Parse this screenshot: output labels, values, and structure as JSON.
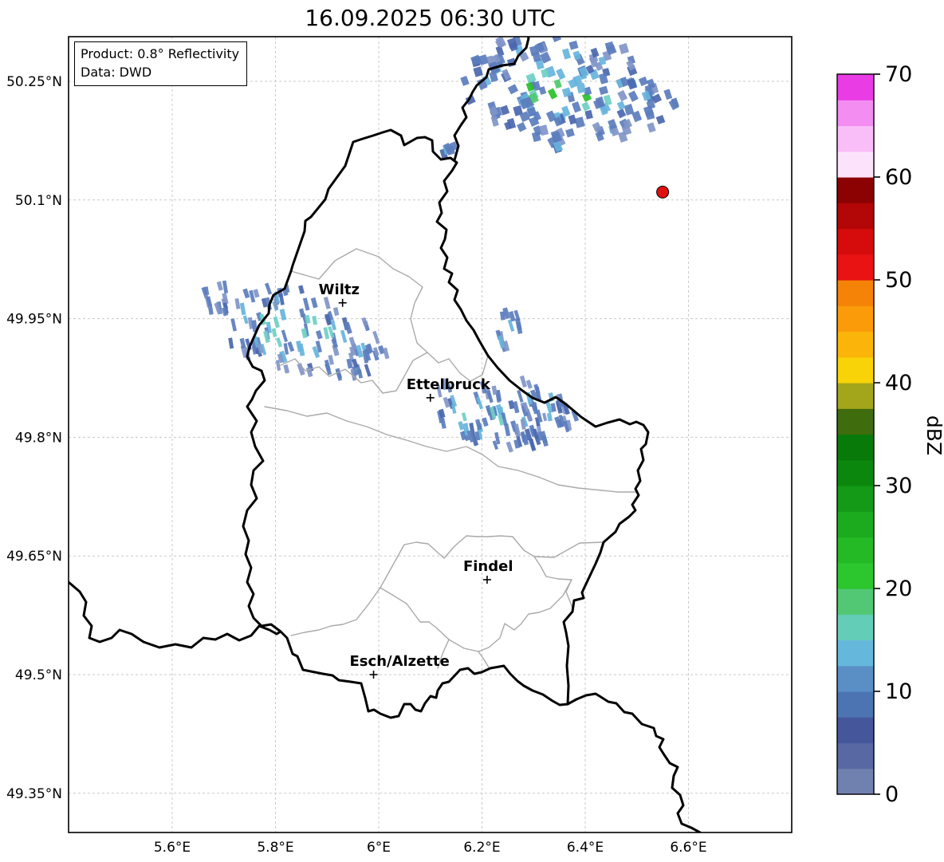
{
  "title": "16.09.2025 06:30 UTC",
  "info_box": {
    "line1": "Product: 0.8° Reflectivity",
    "line2": "Data: DWD"
  },
  "map": {
    "x_ticks": [
      {
        "label": "5.6°E",
        "lon": 5.6
      },
      {
        "label": "5.8°E",
        "lon": 5.8
      },
      {
        "label": "6°E",
        "lon": 6.0
      },
      {
        "label": "6.2°E",
        "lon": 6.2
      },
      {
        "label": "6.4°E",
        "lon": 6.4
      },
      {
        "label": "6.6°E",
        "lon": 6.6
      }
    ],
    "y_ticks": [
      {
        "label": "50.25°N",
        "lat": 50.25
      },
      {
        "label": "50.1°N",
        "lat": 50.1
      },
      {
        "label": "49.95°N",
        "lat": 49.95
      },
      {
        "label": "49.8°N",
        "lat": 49.8
      },
      {
        "label": "49.65°N",
        "lat": 49.65
      },
      {
        "label": "49.5°N",
        "lat": 49.5
      },
      {
        "label": "49.35°N",
        "lat": 49.35
      }
    ],
    "cities": [
      {
        "name": "Wiltz",
        "lon": 5.93,
        "lat": 49.97
      },
      {
        "name": "Ettelbruck",
        "lon": 6.1,
        "lat": 49.85
      },
      {
        "name": "Findel",
        "lon": 6.21,
        "lat": 49.62
      },
      {
        "name": "Esch/Alzette",
        "lon": 5.99,
        "lat": 49.5
      }
    ],
    "radar_site": {
      "lon": 6.55,
      "lat": 50.11,
      "color": "#e01010"
    }
  },
  "colorbar": {
    "label": "dBZ",
    "min": 0,
    "max": 70,
    "segment_step": 2.5,
    "tick_values": [
      0,
      10,
      20,
      30,
      40,
      50,
      60,
      70
    ],
    "colors_bottom_to_top": [
      "#7181af",
      "#5868a3",
      "#45569b",
      "#4c74b3",
      "#5a8fc6",
      "#66b7dc",
      "#63cdb7",
      "#52c874",
      "#2cc62e",
      "#24ba26",
      "#1cab1e",
      "#149a16",
      "#0c870e",
      "#077a0a",
      "#3f6c0d",
      "#a3a51a",
      "#f7d308",
      "#fbb40a",
      "#fb9b09",
      "#f58307",
      "#ea1313",
      "#d60c0c",
      "#b30606",
      "#8c0202",
      "#fde2fb",
      "#f9bdf7",
      "#f48df2",
      "#e93ce5"
    ]
  },
  "chart_data": {
    "type": "radar_reflectivity_map",
    "timestamp_utc": "16.09.2025 06:30",
    "product": "0.8° Reflectivity",
    "data_source": "DWD",
    "map_extent": {
      "lon_min": 5.4,
      "lon_max": 6.8,
      "lat_min": 49.29,
      "lat_max": 50.3
    },
    "grid": "dashed graticule every 0.2°E / 0.15°N",
    "echo_palette": [
      "#8095c8",
      "#5b7dbd",
      "#4a67ae",
      "#66b4dc",
      "#6fcfc4",
      "#4dc96b",
      "#28c128"
    ],
    "echo_clusters": [
      {
        "name": "north-germany-belgium",
        "lon": 6.367,
        "lat": 50.24,
        "rlon": 0.205,
        "rlat": 0.07,
        "cells": 165,
        "style": "block",
        "shear": 0.35,
        "green": 0.22,
        "approx_dbz": "0-35"
      },
      {
        "name": "north-small",
        "lon": 6.343,
        "lat": 50.172,
        "rlon": 0.012,
        "rlat": 0.008,
        "cells": 4,
        "style": "block",
        "shear": 0.2,
        "green": 0.0,
        "approx_dbz": "0-10"
      },
      {
        "name": "ne-border-spot",
        "lon": 6.136,
        "lat": 50.164,
        "rlon": 0.014,
        "rlat": 0.01,
        "cells": 5,
        "style": "block",
        "shear": 0.2,
        "green": 0.0,
        "approx_dbz": "0-15"
      },
      {
        "name": "wiltz-band",
        "lon": 5.835,
        "lat": 49.936,
        "rlon": 0.155,
        "rlat": 0.064,
        "cells": 125,
        "style": "dash",
        "shear": 0.95,
        "green": 0.05,
        "approx_dbz": "0-25"
      },
      {
        "name": "mid-east-spot-1",
        "lon": 6.256,
        "lat": 49.95,
        "rlon": 0.016,
        "rlat": 0.014,
        "cells": 7,
        "style": "dash",
        "shear": 0.5,
        "green": 0.0,
        "approx_dbz": "0-10"
      },
      {
        "name": "mid-east-spot-2",
        "lon": 6.239,
        "lat": 49.921,
        "rlon": 0.012,
        "rlat": 0.01,
        "cells": 5,
        "style": "dash",
        "shear": 0.5,
        "green": 0.0,
        "approx_dbz": "0-10"
      },
      {
        "name": "ettelbruck-band",
        "lon": 6.206,
        "lat": 49.827,
        "rlon": 0.096,
        "rlat": 0.042,
        "cells": 62,
        "style": "dash",
        "shear": 0.85,
        "green": 0.04,
        "approx_dbz": "0-20"
      },
      {
        "name": "east-border-cluster",
        "lon": 6.322,
        "lat": 49.842,
        "rlon": 0.052,
        "rlat": 0.03,
        "cells": 34,
        "style": "dash",
        "shear": 0.6,
        "green": 0.05,
        "approx_dbz": "0-20"
      },
      {
        "name": "south-trail",
        "lon": 6.3,
        "lat": 49.797,
        "rlon": 0.026,
        "rlat": 0.009,
        "cells": 9,
        "style": "dash",
        "shear": 0.4,
        "green": 0.0,
        "approx_dbz": "0-10"
      }
    ]
  }
}
